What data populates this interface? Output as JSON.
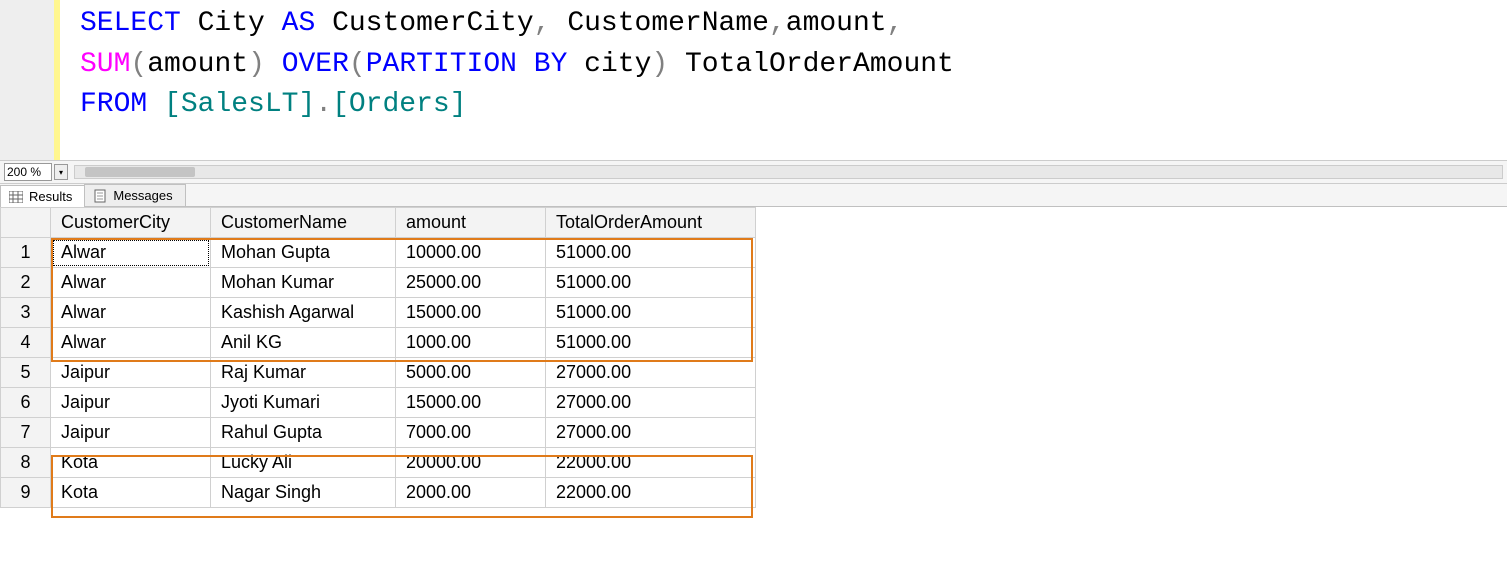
{
  "sql": {
    "line1": {
      "select": "SELECT",
      "city": " City ",
      "as": "AS",
      "alias": " CustomerCity",
      "comma1": ",",
      "cust": " CustomerName",
      "comma2": ",",
      "amount": "amount",
      "comma3": ","
    },
    "line2": {
      "sum": "SUM",
      "open1": "(",
      "amount": "amount",
      "close1": ")",
      "sp1": " ",
      "over": "OVER",
      "open2": "(",
      "partition": "PARTITION",
      "sp2": " ",
      "by": "BY",
      "city": " city",
      "close2": ")",
      "total": " TotalOrderAmount"
    },
    "line3": {
      "from": "FROM",
      "sp": " ",
      "b1": "[SalesLT]",
      "dot": ".",
      "b2": "[Orders]"
    }
  },
  "zoom": {
    "value": "200 %"
  },
  "tabs": {
    "results": "Results",
    "messages": "Messages"
  },
  "grid": {
    "headers": {
      "c1": "CustomerCity",
      "c2": "CustomerName",
      "c3": "amount",
      "c4": "TotalOrderAmount"
    },
    "rows": [
      {
        "n": "1",
        "c1": "Alwar",
        "c2": "Mohan Gupta",
        "c3": "10000.00",
        "c4": "51000.00"
      },
      {
        "n": "2",
        "c1": "Alwar",
        "c2": "Mohan Kumar",
        "c3": "25000.00",
        "c4": "51000.00"
      },
      {
        "n": "3",
        "c1": "Alwar",
        "c2": "Kashish Agarwal",
        "c3": "15000.00",
        "c4": "51000.00"
      },
      {
        "n": "4",
        "c1": "Alwar",
        "c2": "Anil KG",
        "c3": "1000.00",
        "c4": "51000.00"
      },
      {
        "n": "5",
        "c1": "Jaipur",
        "c2": "Raj Kumar",
        "c3": "5000.00",
        "c4": "27000.00"
      },
      {
        "n": "6",
        "c1": "Jaipur",
        "c2": "Jyoti Kumari",
        "c3": "15000.00",
        "c4": "27000.00"
      },
      {
        "n": "7",
        "c1": "Jaipur",
        "c2": "Rahul Gupta",
        "c3": "7000.00",
        "c4": "27000.00"
      },
      {
        "n": "8",
        "c1": "Kota",
        "c2": "Lucky Ali",
        "c3": "20000.00",
        "c4": "22000.00"
      },
      {
        "n": "9",
        "c1": "Kota",
        "c2": "Nagar Singh",
        "c3": "2000.00",
        "c4": "22000.00"
      }
    ]
  }
}
